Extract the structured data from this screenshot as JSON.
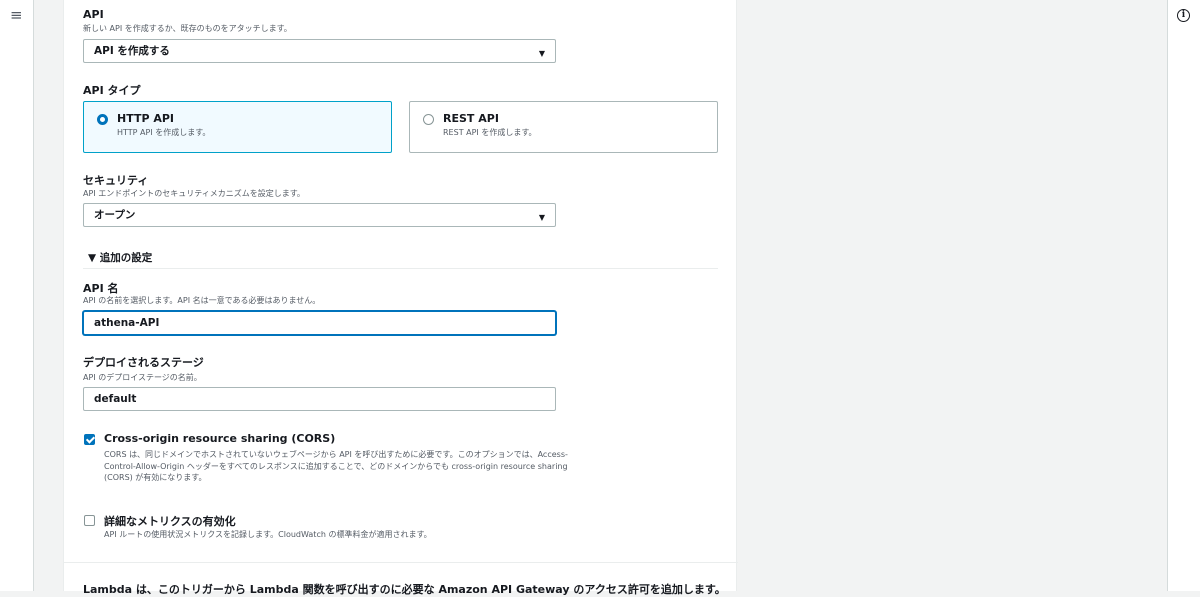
{
  "api": {
    "label": "API",
    "description": "新しい API を作成するか、既存のものをアタッチします。",
    "selected": "API を作成する"
  },
  "api_type": {
    "label": "API タイプ",
    "options": [
      {
        "title": "HTTP API",
        "description": "HTTP API を作成します。",
        "selected": true
      },
      {
        "title": "REST API",
        "description": "REST API を作成します。",
        "selected": false
      }
    ]
  },
  "security": {
    "label": "セキュリティ",
    "description": "API エンドポイントのセキュリティメカニズムを設定します。",
    "selected": "オープン"
  },
  "additional_settings": {
    "label": "▼ 追加の設定"
  },
  "api_name": {
    "label": "API 名",
    "description": "API の名前を選択します。API 名は一意である必要はありません。",
    "value": "athena-API"
  },
  "stage": {
    "label": "デプロイされるステージ",
    "description": "API のデプロイステージの名前。",
    "value": "default"
  },
  "cors": {
    "label": "Cross-origin resource sharing (CORS)",
    "description": "CORS は、同じドメインでホストされていないウェブページから API を呼び出すために必要です。このオプションでは、Access-Control-Allow-Origin ヘッダーをすべてのレスポンスに追加することで、どのドメインからでも cross-origin resource sharing (CORS) が有効になります。",
    "checked": true
  },
  "metrics": {
    "label": "詳細なメトリクスの有効化",
    "description": "API ルートの使用状況メトリクスを記録します。CloudWatch の標準料金が適用されます。",
    "checked": false
  },
  "footer_text": "Lambda は、このトリガーから Lambda 関数を呼び出すのに必要な Amazon API Gateway のアクセス許可を追加します。",
  "icons": {
    "menu": "≡",
    "info": "i",
    "caret": "▼"
  },
  "colors": {
    "accent": "#0073bb",
    "selected_tile_border": "#00a1c9",
    "selected_tile_bg": "#f1faff"
  }
}
